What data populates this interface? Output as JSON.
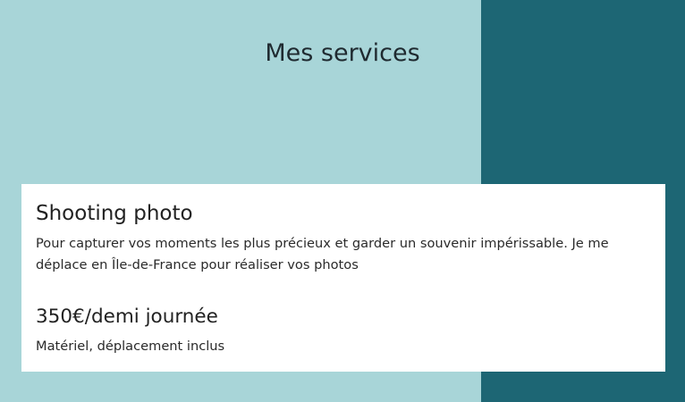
{
  "section": {
    "title": "Mes services"
  },
  "service": {
    "name": "Shooting photo",
    "description": "Pour capturer vos moments les plus précieux et garder un souvenir impérissable. Je me déplace en Île-de-France pour réaliser vos photos",
    "price": "350€/demi journée",
    "includes": "Matériel, déplacement inclus"
  },
  "colors": {
    "background_light": "#a8d5d8",
    "panel_dark": "#1d6674",
    "card": "#ffffff",
    "text": "#222222"
  }
}
